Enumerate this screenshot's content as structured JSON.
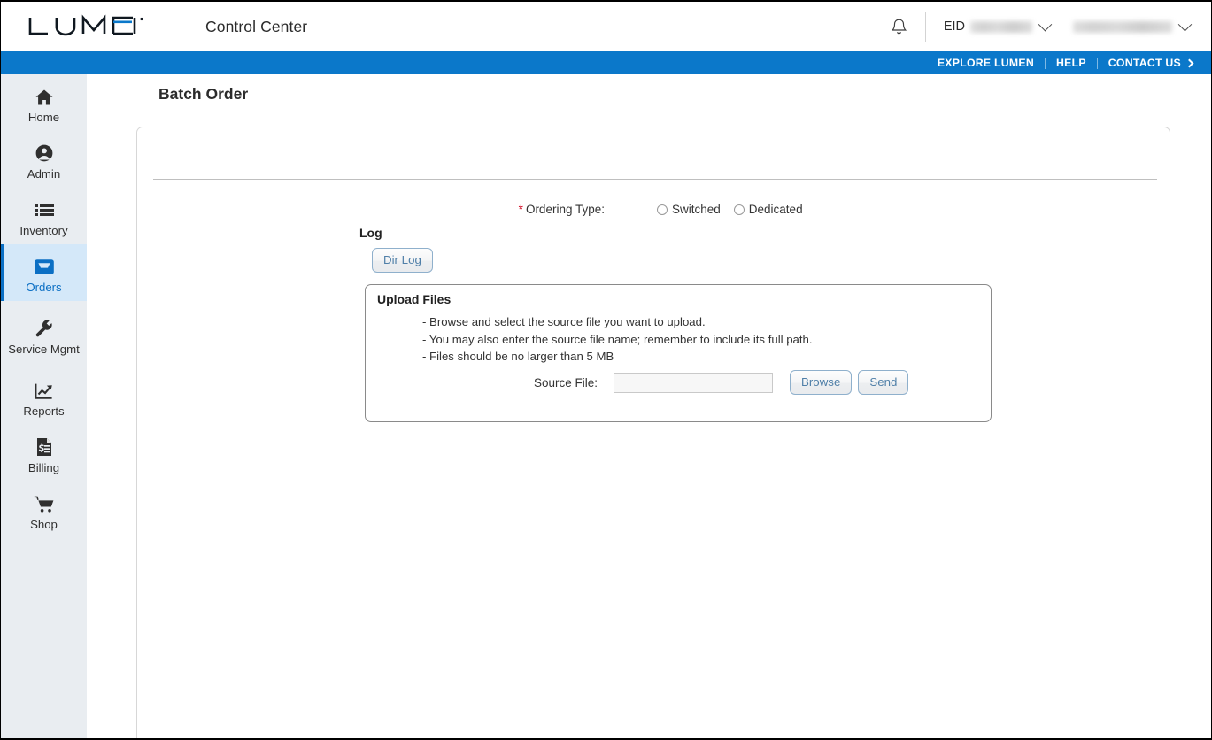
{
  "header": {
    "logo_text": "LUMEN",
    "logo_mark": "lumen-logo",
    "app_title": "Control Center",
    "notifications_icon": "bell-icon",
    "eid_label": "EID",
    "eid_value": "",
    "eid_caret_icon": "chevron-down-icon",
    "user_value": "",
    "user_caret_icon": "chevron-down-icon"
  },
  "utilitynav": {
    "items": [
      {
        "label": "EXPLORE LUMEN",
        "arrow": false
      },
      {
        "label": "HELP",
        "arrow": false
      },
      {
        "label": "CONTACT US",
        "arrow": true,
        "arrow_icon": "chevron-right-icon"
      }
    ]
  },
  "sidebar": {
    "items": [
      {
        "label": "Home",
        "icon": "home-icon",
        "active": false
      },
      {
        "label": "Admin",
        "icon": "user-icon",
        "active": false
      },
      {
        "label": "Inventory",
        "icon": "list-icon",
        "active": false
      },
      {
        "label": "Orders",
        "icon": "inbox-icon",
        "active": true
      },
      {
        "label": "Service Mgmt",
        "icon": "wrench-icon",
        "active": false
      },
      {
        "label": "Reports",
        "icon": "chart-icon",
        "active": false
      },
      {
        "label": "Billing",
        "icon": "invoice-icon",
        "active": false
      },
      {
        "label": "Shop",
        "icon": "cart-icon",
        "active": false
      }
    ]
  },
  "main": {
    "page_title": "Batch Order",
    "ordering_type": {
      "required_marker": "*",
      "label": "Ordering Type:",
      "options": [
        {
          "label": "Switched",
          "selected": false
        },
        {
          "label": "Dedicated",
          "selected": false
        }
      ]
    },
    "log": {
      "section_title": "Log",
      "dir_log_button": "Dir Log"
    },
    "upload": {
      "panel_title": "Upload Files",
      "instructions": [
        "- Browse and select the source file you want to upload.",
        "- You may also enter the source file name; remember to include its full path.",
        "- Files should be no larger than 5 MB"
      ],
      "source_file_label": "Source File:",
      "source_file_value": "",
      "source_file_placeholder": "",
      "browse_button": "Browse",
      "send_button": "Send"
    }
  },
  "colors": {
    "brand_blue": "#0b78ca",
    "active_nav_blue": "#0b6fc4",
    "active_nav_bg": "#d4e8f9",
    "sidebar_bg": "#e9edf1",
    "required_red": "#d0021b",
    "button_text": "#4f7fa8"
  }
}
